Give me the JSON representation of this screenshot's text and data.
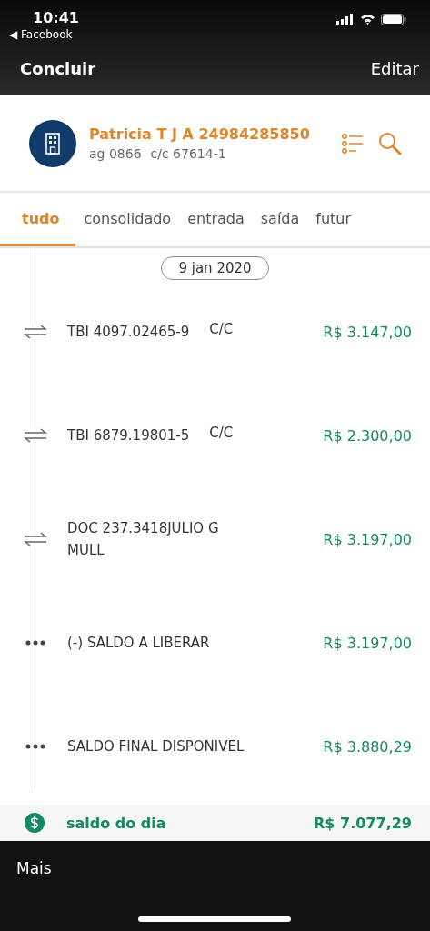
{
  "status_bar": {
    "time": "10:41",
    "back_app": "◀ Facebook"
  },
  "nav": {
    "left": "Concluir",
    "right": "Editar"
  },
  "account": {
    "name": "Patricia T J A 24984285850",
    "agency": "ag 0866",
    "account": "c/c 67614-1"
  },
  "tabs": [
    {
      "label": "tudo",
      "selected": true
    },
    {
      "label": "consolidado",
      "selected": false
    },
    {
      "label": "entrada",
      "selected": false
    },
    {
      "label": "saída",
      "selected": false
    },
    {
      "label": "futur",
      "selected": false
    }
  ],
  "date": "9 jan 2020",
  "transactions": [
    {
      "kind": "transfer",
      "description": "TBI 4097.02465-9",
      "type": "C/C",
      "amount": "R$ 3.147,00"
    },
    {
      "kind": "transfer",
      "description": "TBI 6879.19801-5",
      "type": "C/C",
      "amount": "R$ 2.300,00"
    },
    {
      "kind": "transfer",
      "description": "DOC 237.3418JULIO G MULL",
      "amount": "R$ 3.197,00"
    },
    {
      "kind": "more",
      "description": "(-) SALDO A LIBERAR",
      "amount": "R$ 3.197,00"
    },
    {
      "kind": "more",
      "description": "SALDO FINAL DISPONIVEL",
      "amount": "R$ 3.880,29"
    }
  ],
  "day_balance": {
    "label": "saldo do dia",
    "amount": "R$ 7.077,29"
  },
  "bottom_bar": {
    "label": "Mais"
  }
}
